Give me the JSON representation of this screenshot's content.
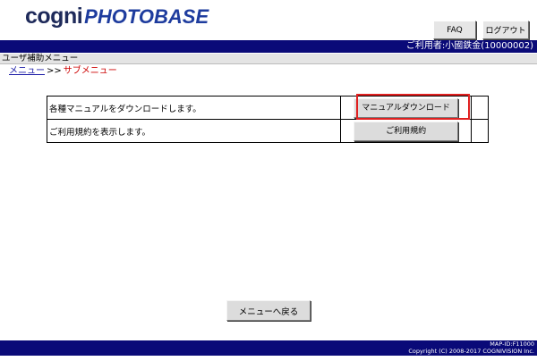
{
  "header": {
    "logo_cogni": "cogni",
    "logo_photobase": "PHOTOBASE",
    "faq_label": "FAQ",
    "logout_label": "ログアウト"
  },
  "user_bar": {
    "text": "ご利用者:小國鉄金(10000002)"
  },
  "sub_bar": {
    "title": "ユーザ補助メニュー"
  },
  "breadcrumb": {
    "menu_link": "メニュー",
    "separator": ">>",
    "current": "サブメニュー"
  },
  "menu_rows": [
    {
      "description": "各種マニュアルをダウンロードします。",
      "button": "マニュアルダウンロード"
    },
    {
      "description": "ご利用規約を表示します。",
      "button": "ご利用規約"
    }
  ],
  "back_button": "メニューへ戻る",
  "footer": {
    "page_id": "MAP-ID:F11000",
    "copyright": "Copyright (C) 2008-2017 COGNIVISION Inc."
  },
  "colors": {
    "bar_navy": "#0a0a78",
    "highlight_red": "#e02020",
    "breadcrumb_current": "#cc0000"
  }
}
